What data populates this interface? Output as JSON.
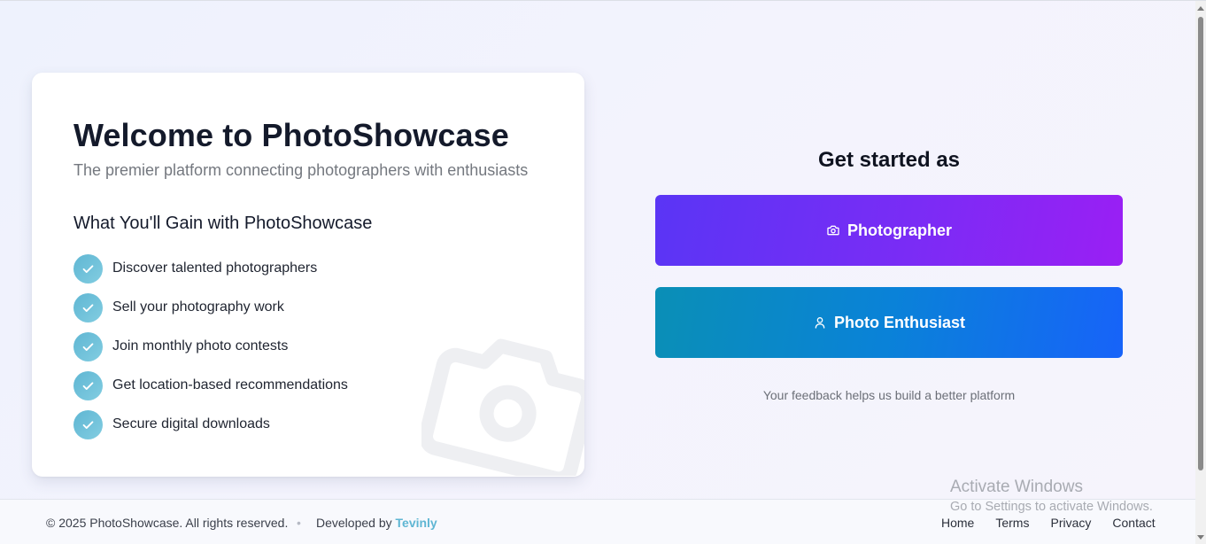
{
  "card": {
    "title": "Welcome to PhotoShowcase",
    "subtitle": "The premier platform connecting photographers with enthusiasts",
    "gain_heading": "What You'll Gain with PhotoShowcase",
    "features": [
      "Discover talented photographers",
      "Sell your photography work",
      "Join monthly photo contests",
      "Get location-based recommendations",
      "Secure digital downloads"
    ],
    "feature_icon": "check-icon",
    "background_icon": "camera-icon"
  },
  "get_started": {
    "title": "Get started as",
    "photographer_label": "Photographer",
    "photographer_icon": "camera-icon",
    "enthusiast_label": "Photo Enthusiast",
    "enthusiast_icon": "user-icon",
    "feedback": "Your feedback helps us build a better platform"
  },
  "footer": {
    "copyright": "© 2025 PhotoShowcase. All rights reserved.",
    "separator": "•",
    "developed_prefix": "Developed by",
    "developer": "Tevinly",
    "links": [
      "Home",
      "Terms",
      "Privacy",
      "Contact"
    ]
  },
  "watermark": {
    "line1": "Activate Windows",
    "line2": "Go to Settings to activate Windows."
  },
  "colors": {
    "photographer_gradient": [
      "#5a35f5",
      "#9a1ff4"
    ],
    "enthusiast_gradient": [
      "#0a8fb6",
      "#1763f9"
    ],
    "check_accent": "#5fb6d3",
    "brand_link": "#5fb6d3"
  }
}
